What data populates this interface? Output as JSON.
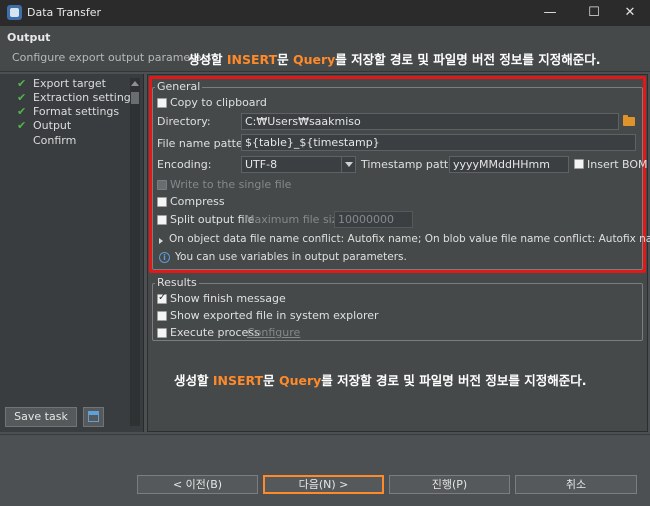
{
  "window": {
    "title": "Data Transfer",
    "controls": [
      "—",
      "☐",
      "✕"
    ]
  },
  "header": {
    "heading": "Output",
    "subtitle": "Configure export output parameters",
    "annotation": {
      "before": "생성할 ",
      "hl1": "INSERT",
      "mid": "문 ",
      "hl2": "Query",
      "after": "를 저장할 경로 및 파일명 버전 정보를 지정해준다."
    }
  },
  "nav": {
    "items": [
      {
        "label": "Export target",
        "checked": true
      },
      {
        "label": "Extraction settings",
        "checked": true
      },
      {
        "label": "Format settings",
        "checked": true
      },
      {
        "label": "Output",
        "checked": true
      },
      {
        "label": "Confirm",
        "checked": false
      }
    ],
    "check_glyph": "✔",
    "save_task_label": "Save task",
    "task_icon": "task-config-icon"
  },
  "general": {
    "title": "General",
    "copy_to_clipboard": {
      "label": "Copy to clipboard",
      "checked": false
    },
    "directory_label": "Directory:",
    "directory_value": "C:₩Users₩saakmiso",
    "folder_icon": "folder-icon",
    "file_name_pattern_label": "File name pattern:",
    "file_name_pattern_value": "${table}_${timestamp}",
    "encoding_label": "Encoding:",
    "encoding_value": "UTF-8",
    "timestamp_label": "Timestamp pattern:",
    "timestamp_value": "yyyyMMddHHmm",
    "insert_bom": {
      "label": "Insert BOM",
      "checked": false
    },
    "write_single_file": {
      "label": "Write to the single file",
      "checked": false,
      "enabled": false
    },
    "compress": {
      "label": "Compress",
      "checked": false
    },
    "split_output": {
      "label": "Split output file",
      "checked": false
    },
    "max_file_size_label": "Maximum file size:",
    "max_file_size_value": "10000000",
    "conflict_text": "On object data file name conflict: Autofix name; On blob value file name conflict: Autofix name",
    "info_text": "You can use variables in output parameters.",
    "info_glyph": "i"
  },
  "results": {
    "title": "Results",
    "show_finish": {
      "label": "Show finish message",
      "checked": true
    },
    "show_exported": {
      "label": "Show exported file in system explorer",
      "checked": false
    },
    "execute_process": {
      "label": "Execute process",
      "checked": false
    },
    "configure_label": "Configure"
  },
  "main_annotation": {
    "before": "생성할 ",
    "hl1": "INSERT",
    "mid": "문 ",
    "hl2": "Query",
    "after": "를 저장할 경로 및 파일명 버전 정보를 지정해준다."
  },
  "footer": {
    "prev_label": "< 이전(B)",
    "next_label": "다음(N) >",
    "proceed_label": "진행(P)",
    "cancel_label": "취소"
  },
  "colors": {
    "highlight_frame": "#e01818",
    "annotation_accent": "#ff8a2a",
    "check_green": "#52b54b",
    "background": "#4c5052"
  }
}
